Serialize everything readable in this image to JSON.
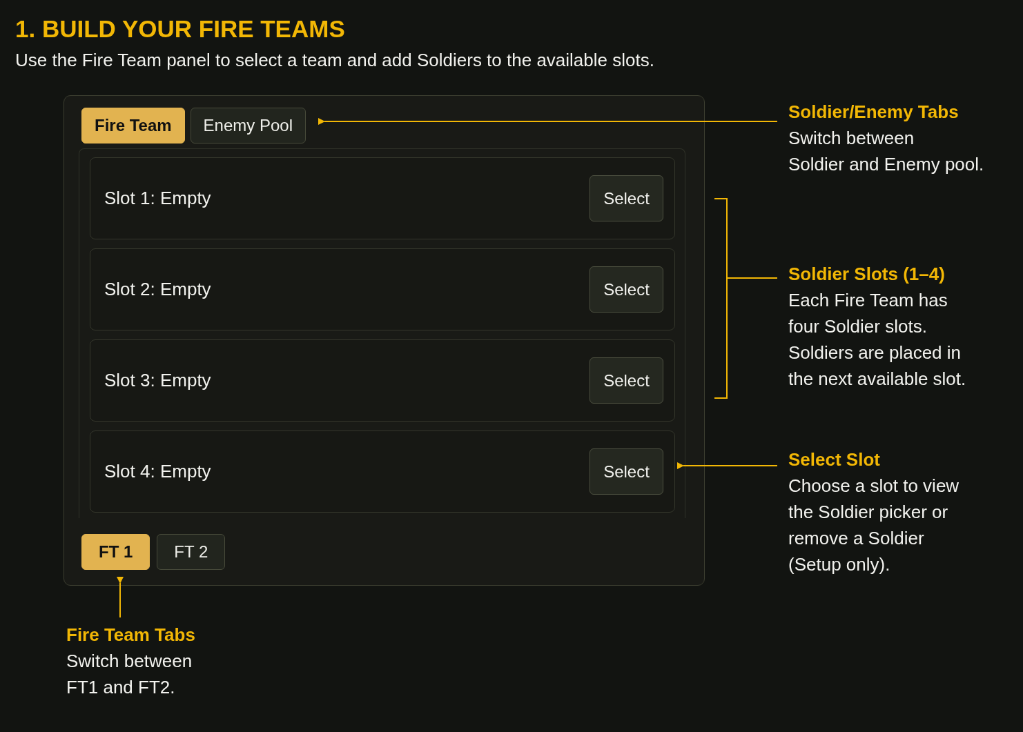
{
  "heading": "1. BUILD YOUR FIRE TEAMS",
  "intro": "Use the Fire Team panel to select a team and add Soldiers to the available slots.",
  "pool_tabs": [
    {
      "label": "Fire Team",
      "selected": true
    },
    {
      "label": "Enemy Pool",
      "selected": false
    }
  ],
  "slots": [
    {
      "label": "Slot 1: Empty",
      "button": "Select"
    },
    {
      "label": "Slot 2: Empty",
      "button": "Select"
    },
    {
      "label": "Slot 3: Empty",
      "button": "Select"
    },
    {
      "label": "Slot 4: Empty",
      "button": "Select"
    }
  ],
  "team_tabs": [
    {
      "label": "FT 1",
      "selected": true
    },
    {
      "label": "FT 2",
      "selected": false
    }
  ],
  "callouts": [
    {
      "title": "Soldier/Enemy Tabs",
      "lines": [
        "Switch between",
        "Soldier and Enemy pool."
      ]
    },
    {
      "title": "Soldier Slots (1–4)",
      "lines": [
        "Each Fire Team has",
        "four Soldier slots.",
        "Soldiers are placed in",
        "the next available slot."
      ]
    },
    {
      "title": "Select Slot",
      "lines": [
        "Choose a slot to view",
        "the Soldier picker or",
        "remove a Soldier",
        "(Setup only)."
      ]
    },
    {
      "title": "Fire Team Tabs",
      "lines": [
        "Switch between",
        "FT1 and FT2."
      ]
    }
  ]
}
